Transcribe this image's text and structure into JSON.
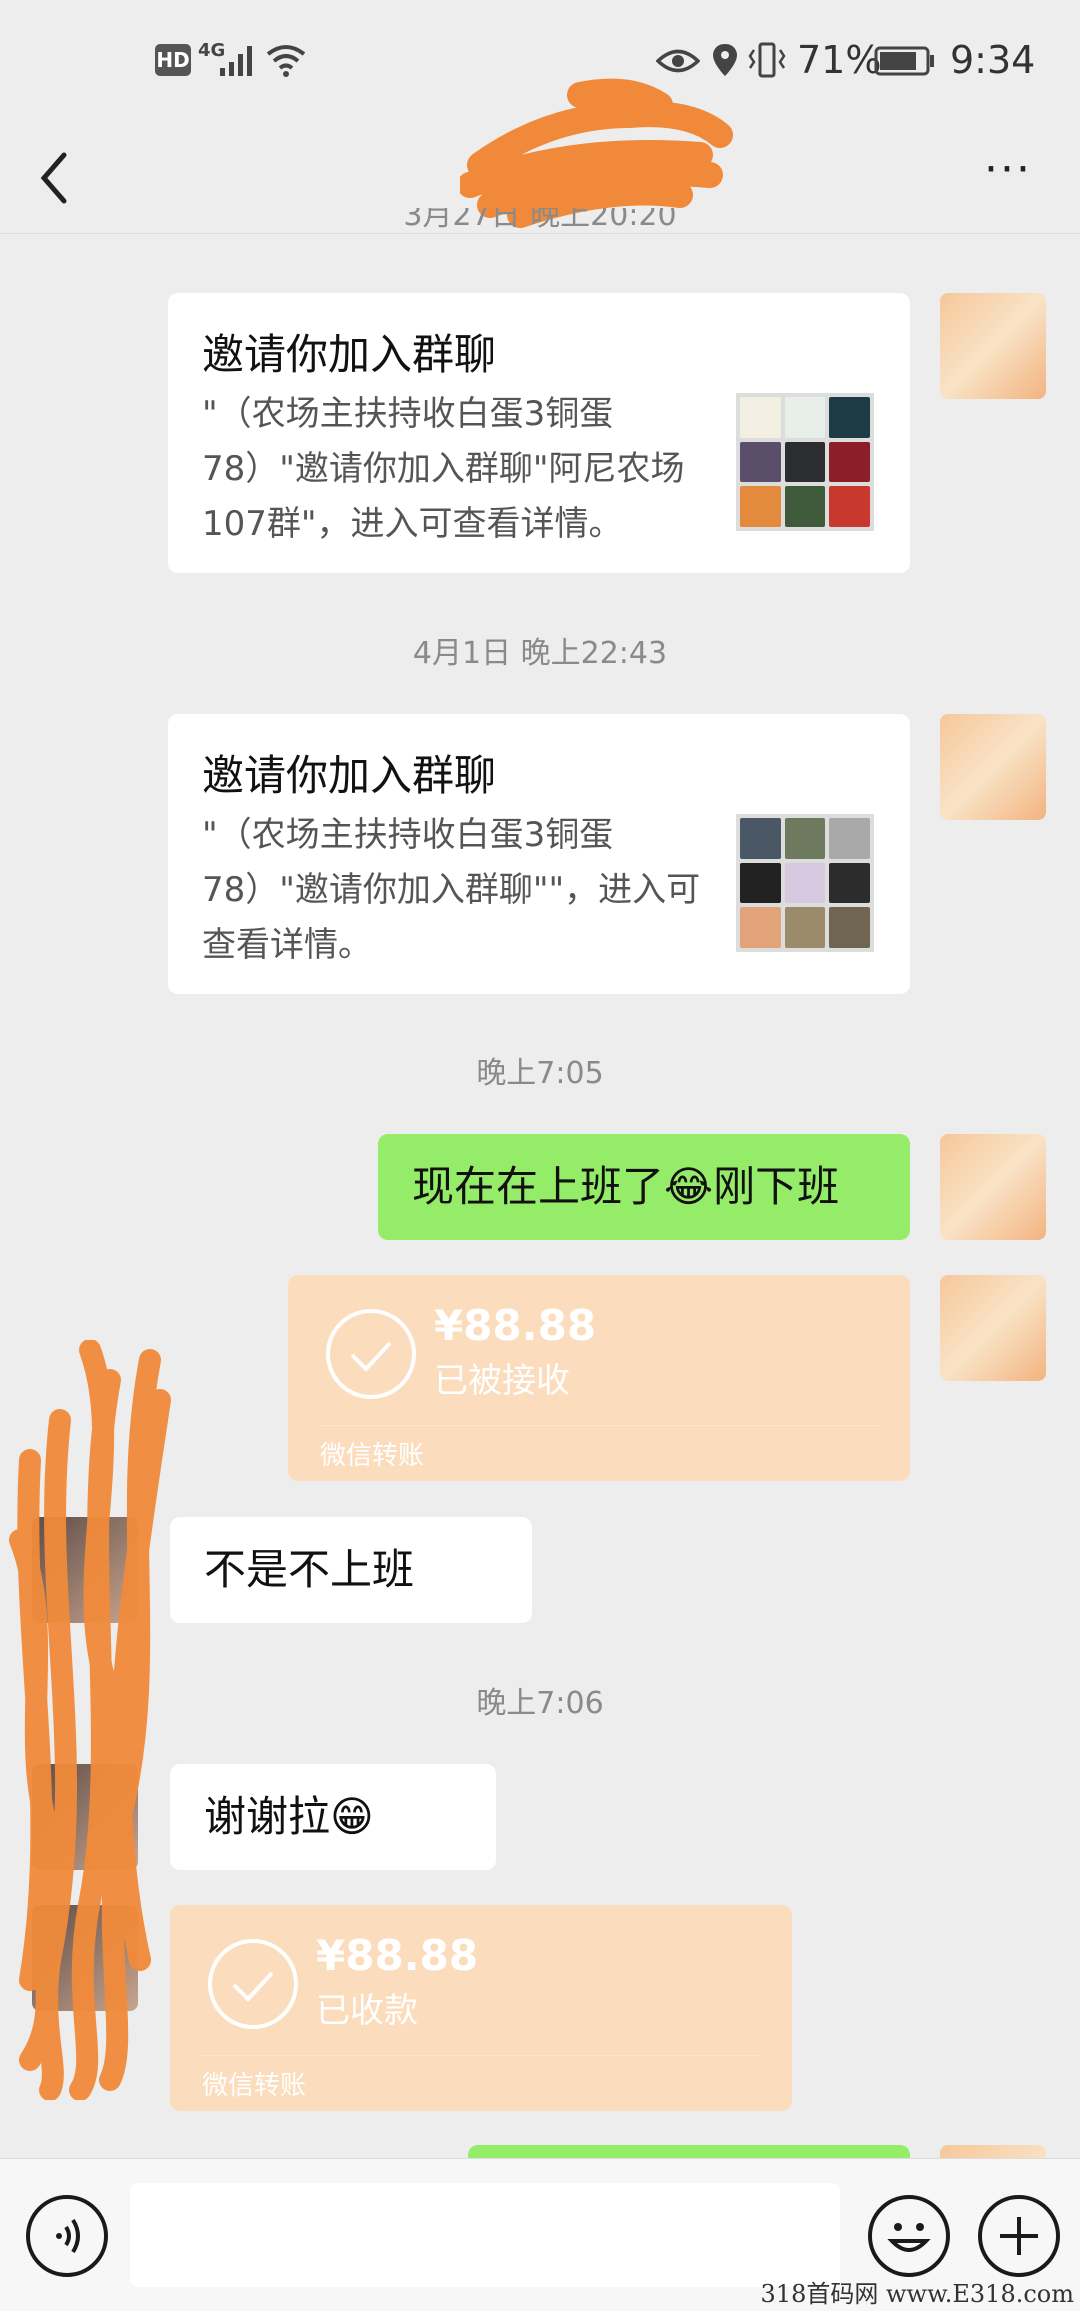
{
  "status_bar": {
    "hd": "HD",
    "network": "4G",
    "battery_percent": "71%",
    "time": "9:34",
    "icons": [
      "hd-icon",
      "signal-icon",
      "wifi-icon",
      "eye-icon",
      "location-icon",
      "vibrate-icon",
      "battery-icon"
    ]
  },
  "header": {
    "more_label": "···",
    "icons": [
      "back-icon",
      "more-icon"
    ]
  },
  "messages": {
    "time_top_partial": "3月27日 晚上20:20",
    "invite1": {
      "title": "邀请你加入群聊",
      "desc": "\"（农场主扶持收白蛋3铜蛋78）\"邀请你加入群聊\"阿尼农场107群\"，进入可查看详情。"
    },
    "time2": "4月1日 晚上22:43",
    "invite2": {
      "title": "邀请你加入群聊",
      "desc": "\"（农场主扶持收白蛋3铜蛋78）\"邀请你加入群聊\"\"，进入可查看详情。"
    },
    "time3": "晚上7:05",
    "sent_text": "现在在上班了😂刚下班",
    "transfer1": {
      "amount": "¥88.88",
      "status": "已被接收",
      "footer": "微信转账"
    },
    "received_text1": "不是不上班",
    "time4": "晚上7:06",
    "received_text2": "谢谢拉😁",
    "transfer2": {
      "amount": "¥88.88",
      "status": "已收款",
      "footer": "微信转账"
    }
  },
  "bottom_bar": {
    "icons": [
      "voice-icon",
      "emoji-icon",
      "plus-icon"
    ]
  },
  "watermark": "318首码网 www.E318.com",
  "colors": {
    "background": "#ededed",
    "sent_bubble": "#95ec69",
    "transfer": "#fbddbd",
    "scribble": "#f08a3a"
  }
}
